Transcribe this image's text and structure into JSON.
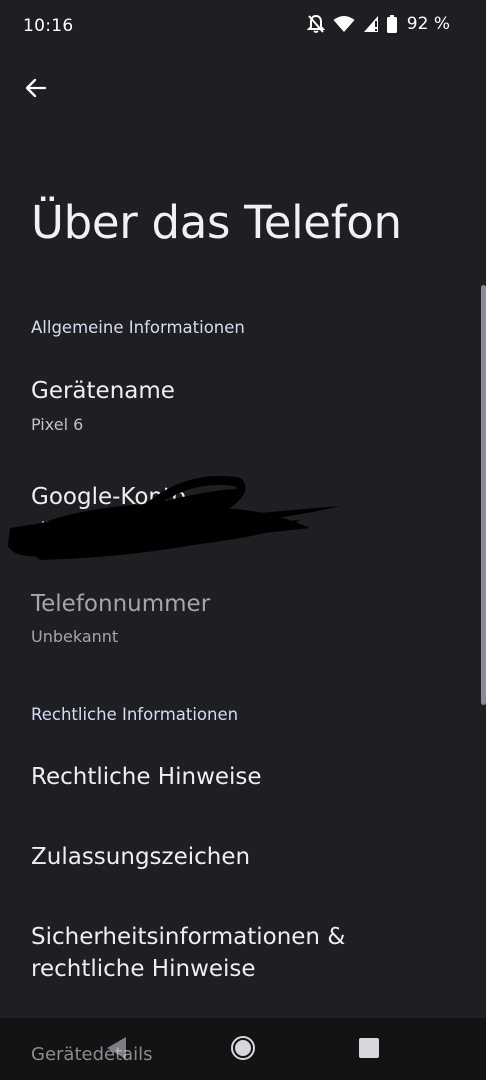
{
  "status_bar": {
    "time": "10:16",
    "battery_percent": "92 %",
    "icons": [
      "notifications-off-icon",
      "wifi-icon",
      "signal-icon",
      "battery-icon"
    ]
  },
  "toolbar": {
    "back_icon": "arrow-back-icon"
  },
  "page": {
    "title": "Über das Telefon"
  },
  "sections": {
    "general": {
      "header": "Allgemeine Informationen",
      "items": [
        {
          "title": "Gerätename",
          "summary": "Pixel 6"
        },
        {
          "title": "Google-Konto",
          "summary": "ail"
        },
        {
          "title": "Telefonnummer",
          "summary": "Unbekannt"
        }
      ]
    },
    "legal": {
      "header": "Rechtliche Informationen",
      "items": [
        {
          "title": "Rechtliche Hinweise"
        },
        {
          "title": "Zulassungszeichen"
        },
        {
          "title": "Sicherheitsinformationen &",
          "title_line2": "rechtliche Hinweise"
        }
      ]
    },
    "device_details": {
      "header": "Gerätedetails"
    }
  },
  "nav_bar": {
    "back_icon": "nav-back-icon",
    "home_icon": "nav-home-icon",
    "recents_icon": "nav-recents-icon"
  },
  "colors": {
    "background": "#1f1f23",
    "section_header": "#d4dcf4",
    "nav_bar": "#131316"
  }
}
